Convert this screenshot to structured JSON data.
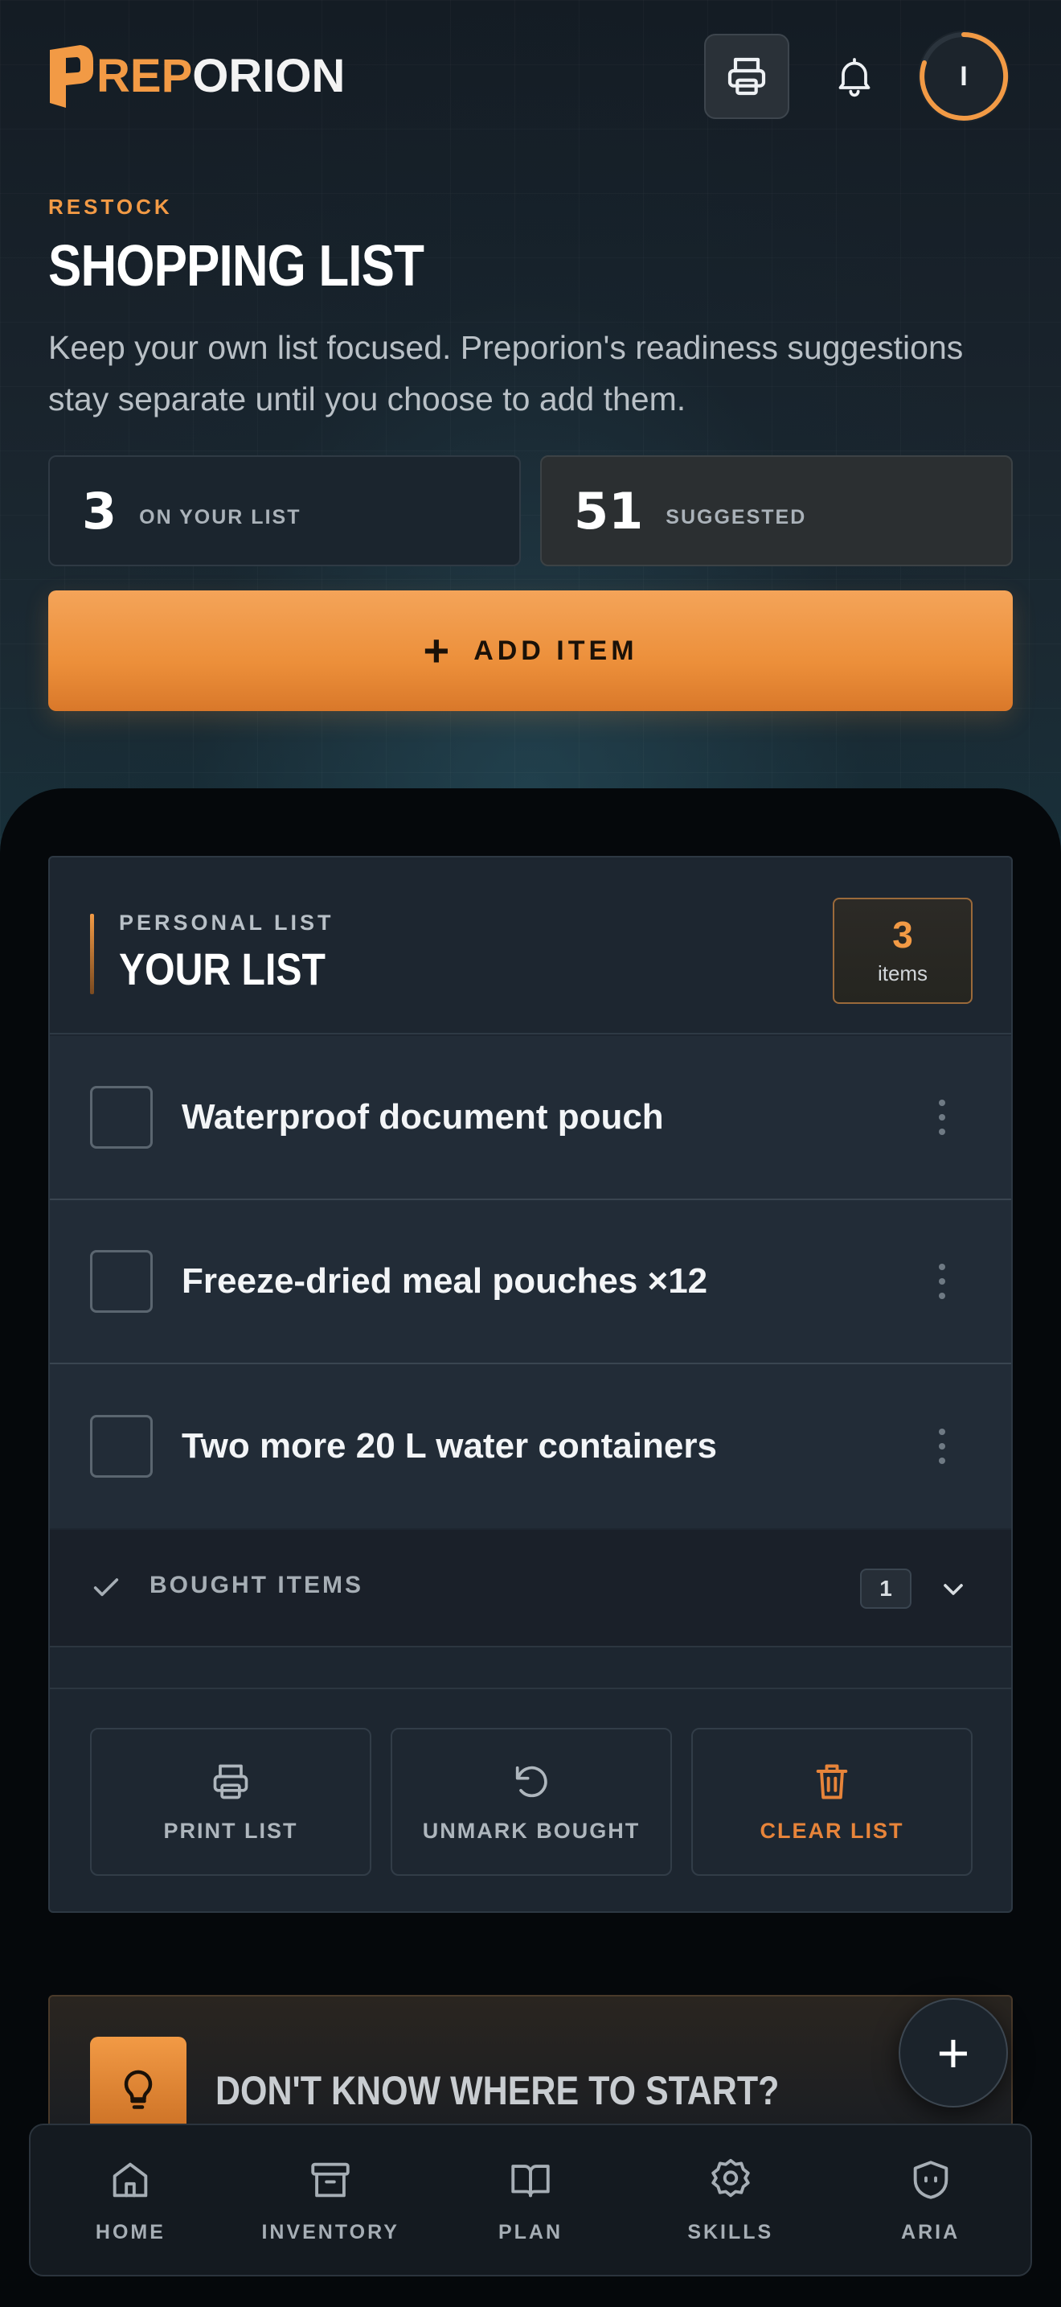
{
  "app": {
    "logo_prefix": "P",
    "logo_accent": "REP",
    "logo_rest": "ORION"
  },
  "header": {
    "avatar_initial": "I"
  },
  "page": {
    "eyebrow": "RESTOCK",
    "title": "SHOPPING LIST",
    "subtitle": "Keep your own list focused. Preporion's readiness suggestions stay separate until you choose to add them."
  },
  "stats": [
    {
      "value": "3",
      "label": "ON YOUR LIST"
    },
    {
      "value": "51",
      "label": "SUGGESTED"
    }
  ],
  "add_button": {
    "label": "ADD ITEM"
  },
  "list_card": {
    "eyebrow": "PERSONAL LIST",
    "title": "YOUR LIST",
    "count_value": "3",
    "count_unit": "items",
    "items": [
      {
        "label": "Waterproof document pouch",
        "checked": false
      },
      {
        "label": "Freeze-dried meal pouches ×12",
        "checked": false
      },
      {
        "label": "Two more 20 L water containers",
        "checked": false
      }
    ],
    "bought": {
      "label": "BOUGHT ITEMS",
      "count": "1"
    },
    "actions": [
      {
        "label": "PRINT LIST",
        "icon": "printer-icon"
      },
      {
        "label": "UNMARK BOUGHT",
        "icon": "undo-icon"
      },
      {
        "label": "CLEAR LIST",
        "icon": "trash-icon"
      }
    ]
  },
  "tip": {
    "title": "DON'T KNOW WHERE TO START?",
    "icon": "lightbulb-icon"
  },
  "fab": {
    "icon": "plus-icon"
  },
  "nav": [
    {
      "label": "HOME",
      "icon": "home-icon"
    },
    {
      "label": "INVENTORY",
      "icon": "archive-icon"
    },
    {
      "label": "PLAN",
      "icon": "book-icon"
    },
    {
      "label": "SKILLS",
      "icon": "badge-icon"
    },
    {
      "label": "ARIA",
      "icon": "shield-icon"
    }
  ],
  "colors": {
    "accent": "#f29a45",
    "danger": "#e7843a",
    "background": "#05080b",
    "card": "#1d2630"
  }
}
